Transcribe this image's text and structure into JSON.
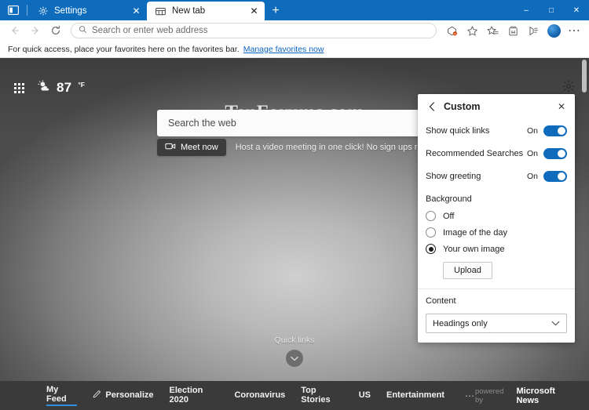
{
  "window": {
    "minimize_label": "–",
    "maximize_label": "□",
    "close_label": "✕"
  },
  "tabs": {
    "tab_search_name": "tab-search-icon",
    "items": [
      {
        "title": "Settings",
        "icon": "gear-icon",
        "active": false,
        "close_label": "✕"
      },
      {
        "title": "New tab",
        "icon": "newtab-icon",
        "active": true,
        "close_label": "✕"
      }
    ],
    "new_tab_label": "+"
  },
  "toolbar": {
    "back_label": "←",
    "forward_label": "→",
    "refresh_label": "↻",
    "address": {
      "placeholder": "Search or enter web address",
      "value": ""
    },
    "icons": [
      "shopping-coupon-icon",
      "favorite-star-icon",
      "favorites-list-icon",
      "collections-icon",
      "read-aloud-icon",
      "profile-avatar-icon",
      "settings-more-icon"
    ],
    "more_label": "⋯"
  },
  "favorites_bar": {
    "message": "For quick access, place your favorites here on the favorites bar.",
    "link": "Manage favorites now"
  },
  "newtab_page": {
    "apps_icon": "waffle-grid-icon",
    "weather": {
      "icon": "sun-cloud-icon",
      "temperature": "87",
      "unit": "°F"
    },
    "settings_icon": "gear-icon",
    "watermark": "TenForums.com",
    "search": {
      "placeholder": "Search the web",
      "value": ""
    },
    "meet_now": {
      "icon": "video-camera-icon",
      "label": "Meet now",
      "caption": "Host a video meeting in one click! No sign ups required."
    },
    "quick_links": {
      "label": "Quick links",
      "chevron": "⌄"
    }
  },
  "custom_panel": {
    "back_label": "‹",
    "title": "Custom",
    "close_label": "✕",
    "toggles": [
      {
        "label": "Show quick links",
        "state": "On",
        "on": true
      },
      {
        "label": "Recommended Searches",
        "state": "On",
        "on": true
      },
      {
        "label": "Show greeting",
        "state": "On",
        "on": true
      }
    ],
    "background": {
      "section_title": "Background",
      "options": [
        {
          "label": "Off",
          "selected": false
        },
        {
          "label": "Image of the day",
          "selected": false
        },
        {
          "label": "Your own image",
          "selected": true
        }
      ],
      "upload_label": "Upload"
    },
    "content": {
      "section_title": "Content",
      "selected": "Headings only",
      "chevron": "⌄"
    }
  },
  "news_bar": {
    "items": [
      {
        "label": "My Feed",
        "icon": null,
        "active": true
      },
      {
        "label": "Personalize",
        "icon": "pencil-icon",
        "active": false
      },
      {
        "label": "Election 2020",
        "icon": null,
        "active": false
      },
      {
        "label": "Coronavirus",
        "icon": null,
        "active": false
      },
      {
        "label": "Top Stories",
        "icon": null,
        "active": false
      },
      {
        "label": "US",
        "icon": null,
        "active": false
      },
      {
        "label": "Entertainment",
        "icon": null,
        "active": false
      }
    ],
    "more_label": "⋯",
    "powered_by": "powered by",
    "brand": "Microsoft News"
  },
  "colors": {
    "titlebar": "#0f6cbd",
    "accent": "#0f6cbd",
    "newsbar": "#3a3a3a",
    "link": "#0a64c2"
  }
}
